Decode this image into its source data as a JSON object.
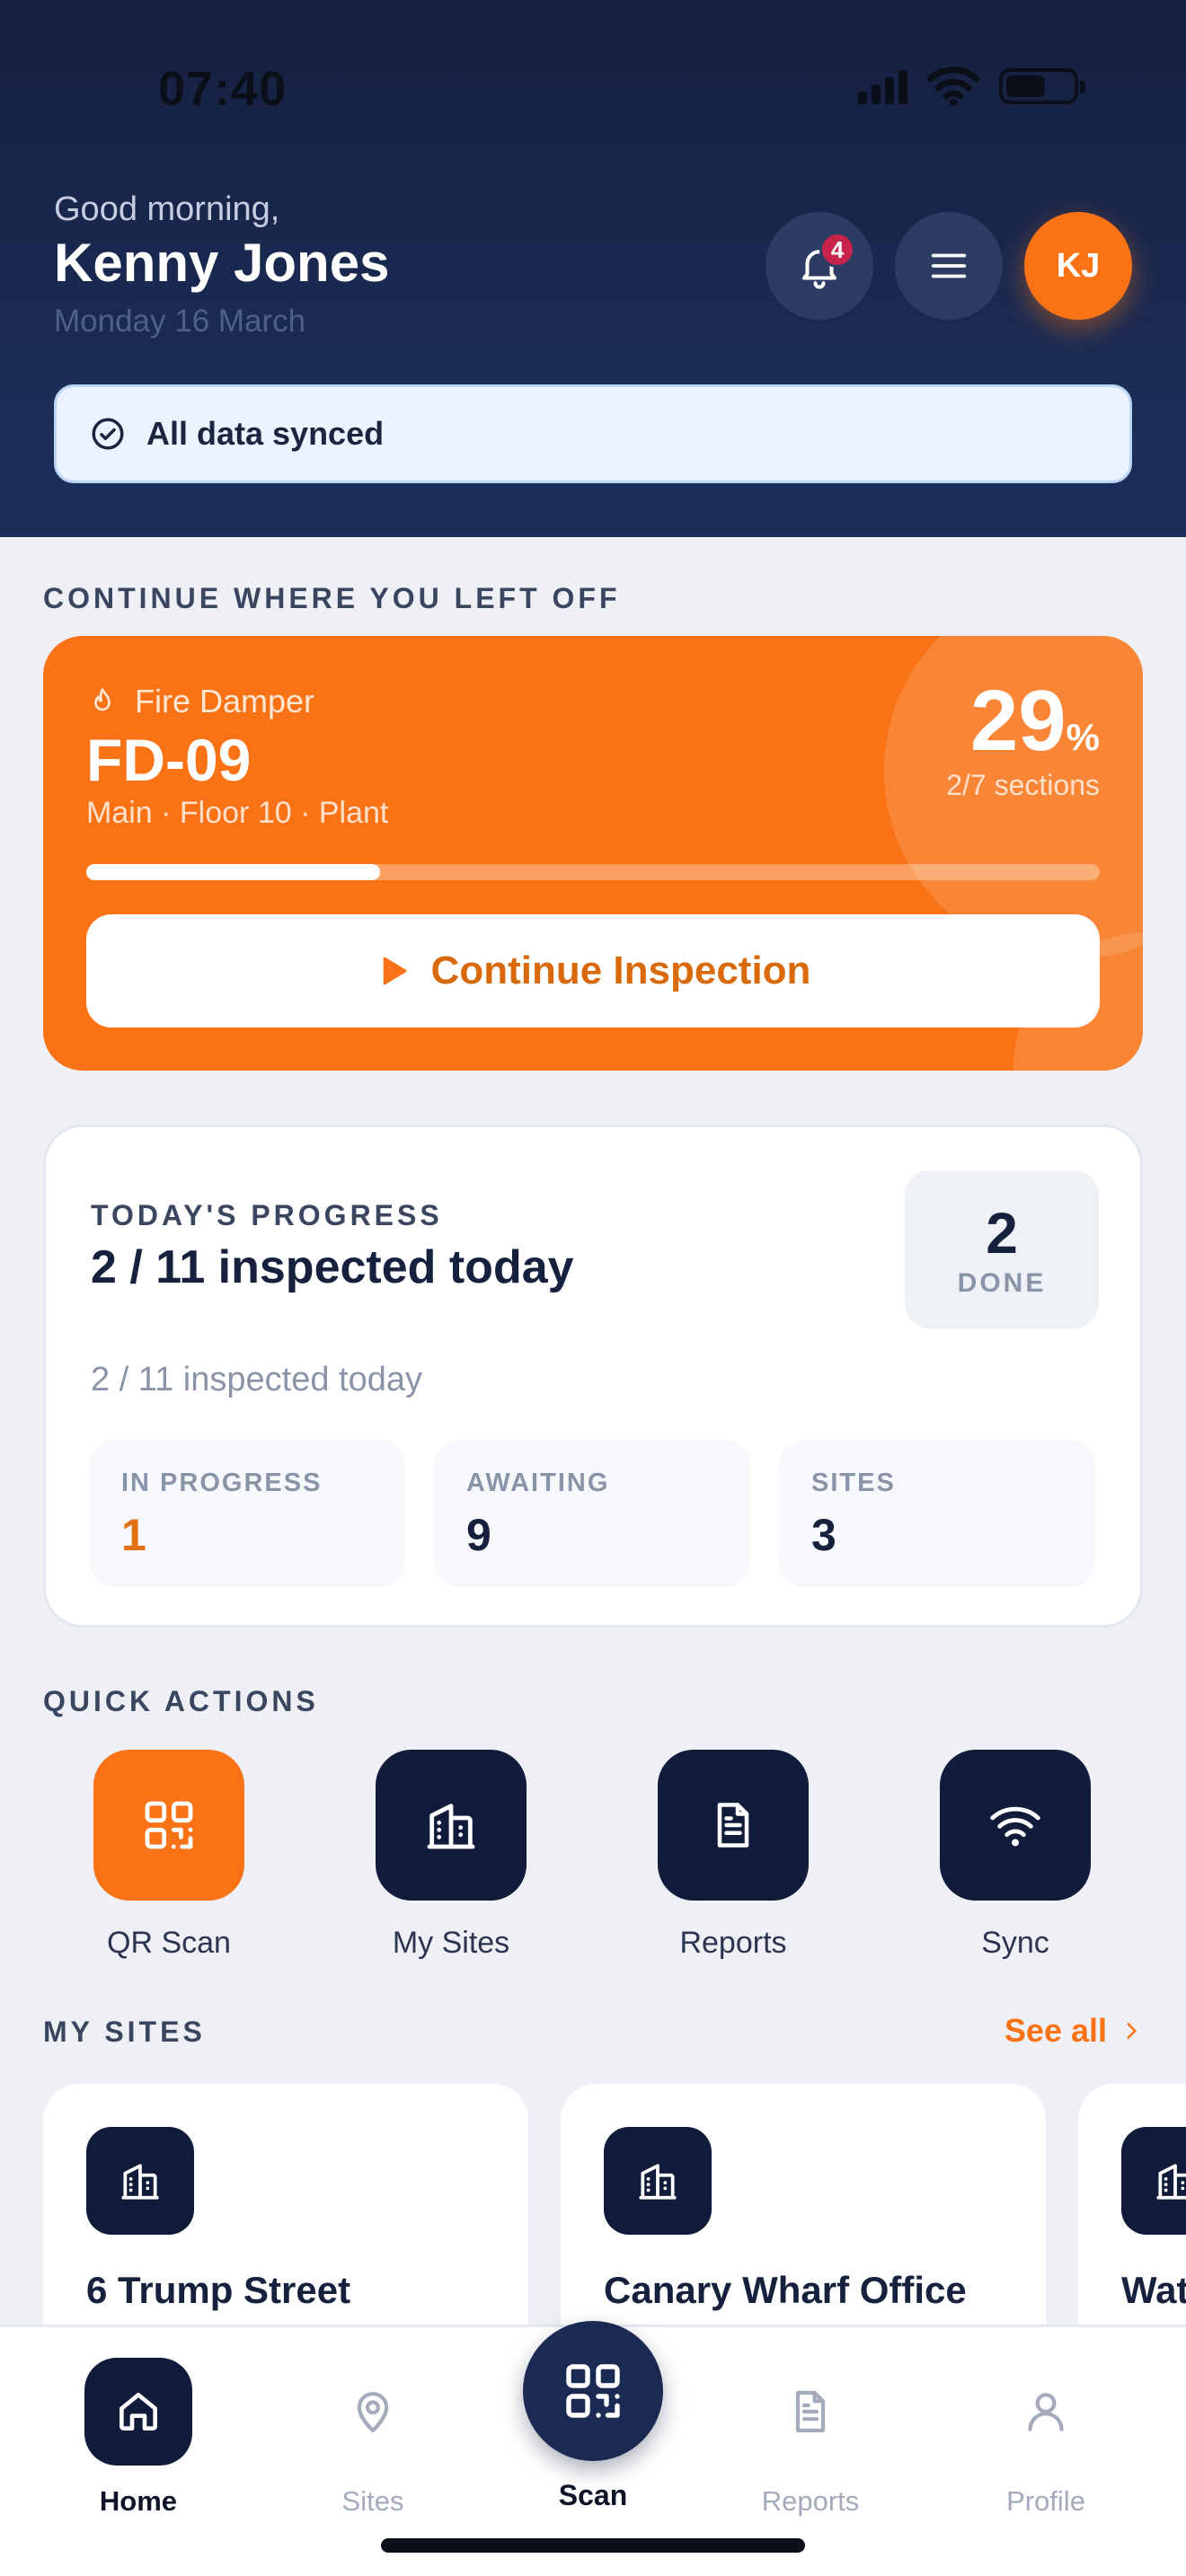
{
  "status_bar": {
    "time": "07:40"
  },
  "header": {
    "greeting": "Good morning,",
    "user_name": "Kenny Jones",
    "date": "Monday 16 March",
    "notification_count": "4",
    "avatar_initials": "KJ",
    "sync_status": "All data synced"
  },
  "continue": {
    "section_title": "CONTINUE WHERE YOU LEFT OFF",
    "asset_type": "Fire Damper",
    "asset_id": "FD-09",
    "location": "Main · Floor 10 · Plant",
    "percent": "29",
    "percent_sign": "%",
    "sections": "2/7 sections",
    "progress_fraction": 0.29,
    "button_label": "Continue Inspection"
  },
  "progress": {
    "label": "TODAY'S PROGRESS",
    "headline": "2 / 11 inspected today",
    "subtext": "2 / 11 inspected today",
    "done_count": "2",
    "done_label": "DONE",
    "stats": [
      {
        "label": "IN PROGRESS",
        "value": "1"
      },
      {
        "label": "AWAITING",
        "value": "9"
      },
      {
        "label": "SITES",
        "value": "3"
      }
    ]
  },
  "quick_actions": {
    "title": "QUICK ACTIONS",
    "items": [
      {
        "label": "QR Scan",
        "icon": "qr-code-icon"
      },
      {
        "label": "My Sites",
        "icon": "building-icon"
      },
      {
        "label": "Reports",
        "icon": "document-icon"
      },
      {
        "label": "Sync",
        "icon": "wifi-icon"
      }
    ]
  },
  "sites": {
    "title": "MY SITES",
    "see_all": "See all",
    "items": [
      {
        "name": "6 Trump Street"
      },
      {
        "name": "Canary Wharf Office"
      },
      {
        "name": "Wat"
      }
    ]
  },
  "bottom_nav": {
    "items": [
      {
        "label": "Home"
      },
      {
        "label": "Sites"
      },
      {
        "label": "Scan"
      },
      {
        "label": "Reports"
      },
      {
        "label": "Profile"
      }
    ]
  },
  "colors": {
    "accent": "#f97316",
    "navy": "#111c3a",
    "header_bg": "#16203f"
  }
}
